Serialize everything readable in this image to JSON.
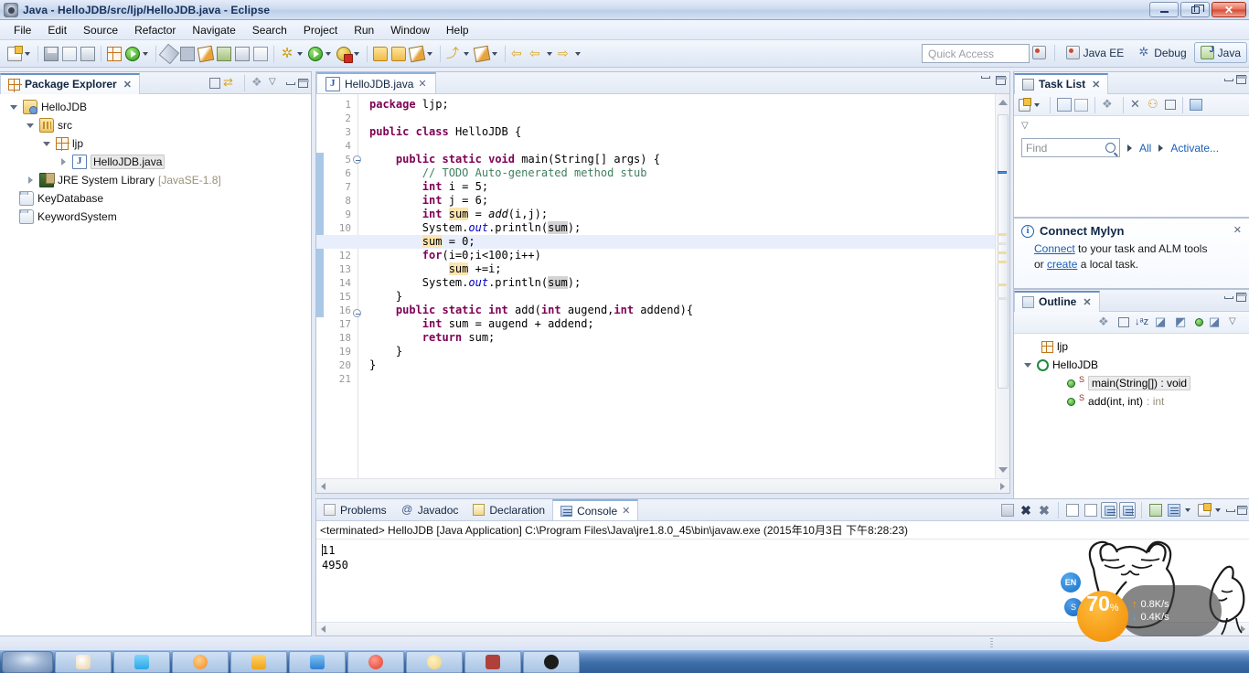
{
  "window": {
    "title": "Java - HelloJDB/src/ljp/HelloJDB.java - Eclipse",
    "app_icon": "eclipse-icon",
    "minimize_label": "Minimize",
    "maximize_label": "Restore",
    "close_label": "Close"
  },
  "menubar": {
    "items": [
      "File",
      "Edit",
      "Source",
      "Refactor",
      "Navigate",
      "Search",
      "Project",
      "Run",
      "Window",
      "Help"
    ]
  },
  "toolbar": {
    "quick_access_placeholder": "Quick Access",
    "perspectives": [
      {
        "label": "Java EE",
        "icon": "java-ee-perspective-icon",
        "active": false
      },
      {
        "label": "Debug",
        "icon": "debug-perspective-icon",
        "active": false
      },
      {
        "label": "Java",
        "icon": "java-perspective-icon",
        "active": true
      }
    ],
    "open_perspective_tooltip": "Open Perspective"
  },
  "package_explorer": {
    "title": "Package Explorer",
    "tree": [
      {
        "label": "HelloJDB",
        "icon": "java-project-icon",
        "indent": 0,
        "twisty": "open",
        "suffix": ""
      },
      {
        "label": "src",
        "icon": "source-folder-icon",
        "indent": 1,
        "twisty": "open",
        "suffix": ""
      },
      {
        "label": "ljp",
        "icon": "package-icon",
        "indent": 2,
        "twisty": "open",
        "suffix": ""
      },
      {
        "label": "HelloJDB.java",
        "icon": "java-file-icon",
        "indent": 3,
        "twisty": "closed",
        "suffix": "",
        "selected": true
      },
      {
        "label": "JRE System Library",
        "icon": "jre-library-icon",
        "indent": 1,
        "twisty": "closed",
        "suffix": "[JavaSE-1.8]"
      },
      {
        "label": "KeyDatabase",
        "icon": "folder-icon",
        "indent": 0,
        "twisty": "none",
        "suffix": ""
      },
      {
        "label": "KeywordSystem",
        "icon": "folder-icon",
        "indent": 0,
        "twisty": "none",
        "suffix": ""
      }
    ]
  },
  "editor": {
    "tab_label": "HelloJDB.java",
    "tab_icon": "java-file-icon",
    "current_line": 11,
    "lines": [
      {
        "n": 1,
        "fold": false,
        "html": "<span class='kw'>package</span> ljp;"
      },
      {
        "n": 2,
        "fold": false,
        "html": ""
      },
      {
        "n": 3,
        "fold": false,
        "html": "<span class='kw'>public</span> <span class='kw'>class</span> HelloJDB {"
      },
      {
        "n": 4,
        "fold": false,
        "html": ""
      },
      {
        "n": 5,
        "fold": true,
        "html": "    <span class='kw'>public</span> <span class='kw'>static</span> <span class='kw'>void</span> main(String[] args) {"
      },
      {
        "n": 6,
        "fold": false,
        "html": "        <span class='cm'>// TODO Auto-generated method stub</span>"
      },
      {
        "n": 7,
        "fold": false,
        "html": "        <span class='kw'>int</span> i = 5;"
      },
      {
        "n": 8,
        "fold": false,
        "html": "        <span class='kw'>int</span> j = 6;"
      },
      {
        "n": 9,
        "fold": false,
        "html": "        <span class='kw'>int</span> <span class='occ'>sum</span> = <span class='mth'>add</span>(i,j);"
      },
      {
        "n": 10,
        "fold": false,
        "html": "        System.<span class='fld'>out</span>.println(<span class='occ2'>sum</span>);"
      },
      {
        "n": 11,
        "fold": false,
        "html": "        <span class='occ'>sum</span> = 0;"
      },
      {
        "n": 12,
        "fold": false,
        "html": "        <span class='kw'>for</span>(i=0;i&lt;100;i++)"
      },
      {
        "n": 13,
        "fold": false,
        "html": "            <span class='occ'>sum</span> +=i;"
      },
      {
        "n": 14,
        "fold": false,
        "html": "        System.<span class='fld'>out</span>.println(<span class='occ2'>sum</span>);"
      },
      {
        "n": 15,
        "fold": false,
        "html": "    }"
      },
      {
        "n": 16,
        "fold": true,
        "html": "    <span class='kw'>public</span> <span class='kw'>static</span> <span class='kw'>int</span> add(<span class='kw'>int</span> augend,<span class='kw'>int</span> addend){"
      },
      {
        "n": 17,
        "fold": false,
        "html": "        <span class='kw'>int</span> sum = augend + addend;"
      },
      {
        "n": 18,
        "fold": false,
        "html": "        <span class='kw'>return</span> sum;"
      },
      {
        "n": 19,
        "fold": false,
        "html": "    }"
      },
      {
        "n": 20,
        "fold": false,
        "html": "}"
      },
      {
        "n": 21,
        "fold": false,
        "html": ""
      }
    ]
  },
  "task_list": {
    "title": "Task List",
    "find_placeholder": "Find",
    "filter_all_label": "All",
    "activate_label": "Activate...",
    "toolbar_icons": [
      "new-task-icon",
      "dropdown-icon",
      "categorized-view-icon",
      "scheduled-view-icon",
      "synchronize-icon",
      "focus-icon",
      "collapse-all-icon",
      "restore-icon",
      "view-menu-icon"
    ]
  },
  "mylyn": {
    "title": "Connect Mylyn",
    "text_before": "",
    "connect_link": "Connect",
    "mid_text": " to your task and ALM tools",
    "or_text": "or ",
    "create_link": "create",
    "after_text": " a local task.",
    "close_label": "Close"
  },
  "outline": {
    "title": "Outline",
    "items": [
      {
        "label": "ljp",
        "icon": "package-icon",
        "indent": 1,
        "twisty": "none",
        "modifier": "",
        "type": "",
        "selected": false
      },
      {
        "label": "HelloJDB",
        "icon": "class-icon",
        "indent": 0,
        "twisty": "open",
        "modifier": "",
        "type": "",
        "selected": false
      },
      {
        "label": "main(String[])",
        "icon": "public-method-icon",
        "indent": 2,
        "twisty": "none",
        "modifier": "S",
        "type": ": void",
        "selected": true
      },
      {
        "label": "add(int, int)",
        "icon": "public-method-icon",
        "indent": 2,
        "twisty": "none",
        "modifier": "S",
        "type": ": int",
        "selected": false
      }
    ]
  },
  "console": {
    "tabs": [
      {
        "label": "Problems",
        "icon": "problems-icon",
        "selected": false
      },
      {
        "label": "Javadoc",
        "icon": "javadoc-icon",
        "selected": false
      },
      {
        "label": "Declaration",
        "icon": "declaration-icon",
        "selected": false
      },
      {
        "label": "Console",
        "icon": "console-icon",
        "selected": true
      }
    ],
    "header": "<terminated> HelloJDB [Java Application] C:\\Program Files\\Java\\jre1.8.0_45\\bin\\javaw.exe (2015年10月3日 下午8:28:23)",
    "output": [
      "11",
      "4950"
    ],
    "toolbar_icons": [
      "terminate-icon",
      "remove-launch-icon",
      "remove-all-terminated-icon",
      "clear-console-icon",
      "lock-scroll-icon",
      "scroll-lock-icon",
      "show-console-when-output-icon",
      "pin-console-icon",
      "display-selected-console-icon",
      "open-console-icon",
      "minimize-icon",
      "maximize-icon"
    ]
  },
  "system_monitor": {
    "cpu_value": "70",
    "cpu_unit": "%",
    "upload": "0.8K/s",
    "download": "0.4K/s",
    "upload_icon": "upload-arrow-icon",
    "download_icon": "download-arrow-icon",
    "lang_badge": "EN",
    "lang_badge2": "S"
  }
}
